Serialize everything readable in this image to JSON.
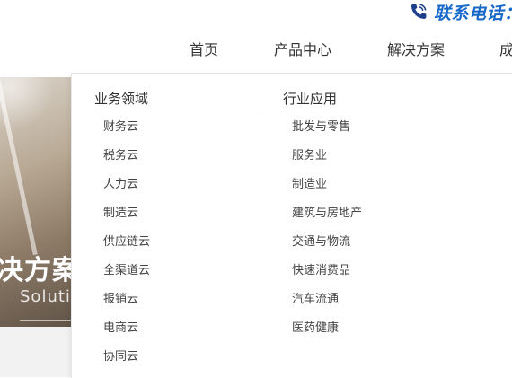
{
  "contact": {
    "text": "联系电话：",
    "icon": "phone-icon",
    "color": "#1769c9"
  },
  "nav": {
    "items": [
      {
        "label": "首页"
      },
      {
        "label": "产品中心"
      },
      {
        "label": "解决方案"
      },
      {
        "label": "成"
      }
    ]
  },
  "hero": {
    "title": "决方案",
    "subtitle": "Soluti"
  },
  "dropdown": {
    "columns": [
      {
        "title": "业务领域",
        "items": [
          "财务云",
          "税务云",
          "人力云",
          "制造云",
          "供应链云",
          "全渠道云",
          "报销云",
          "电商云",
          "协同云"
        ]
      },
      {
        "title": "行业应用",
        "items": [
          "批发与零售",
          "服务业",
          "制造业",
          "建筑与房地产",
          "交通与物流",
          "快速消费品",
          "汽车流通",
          "医药健康"
        ]
      }
    ]
  }
}
